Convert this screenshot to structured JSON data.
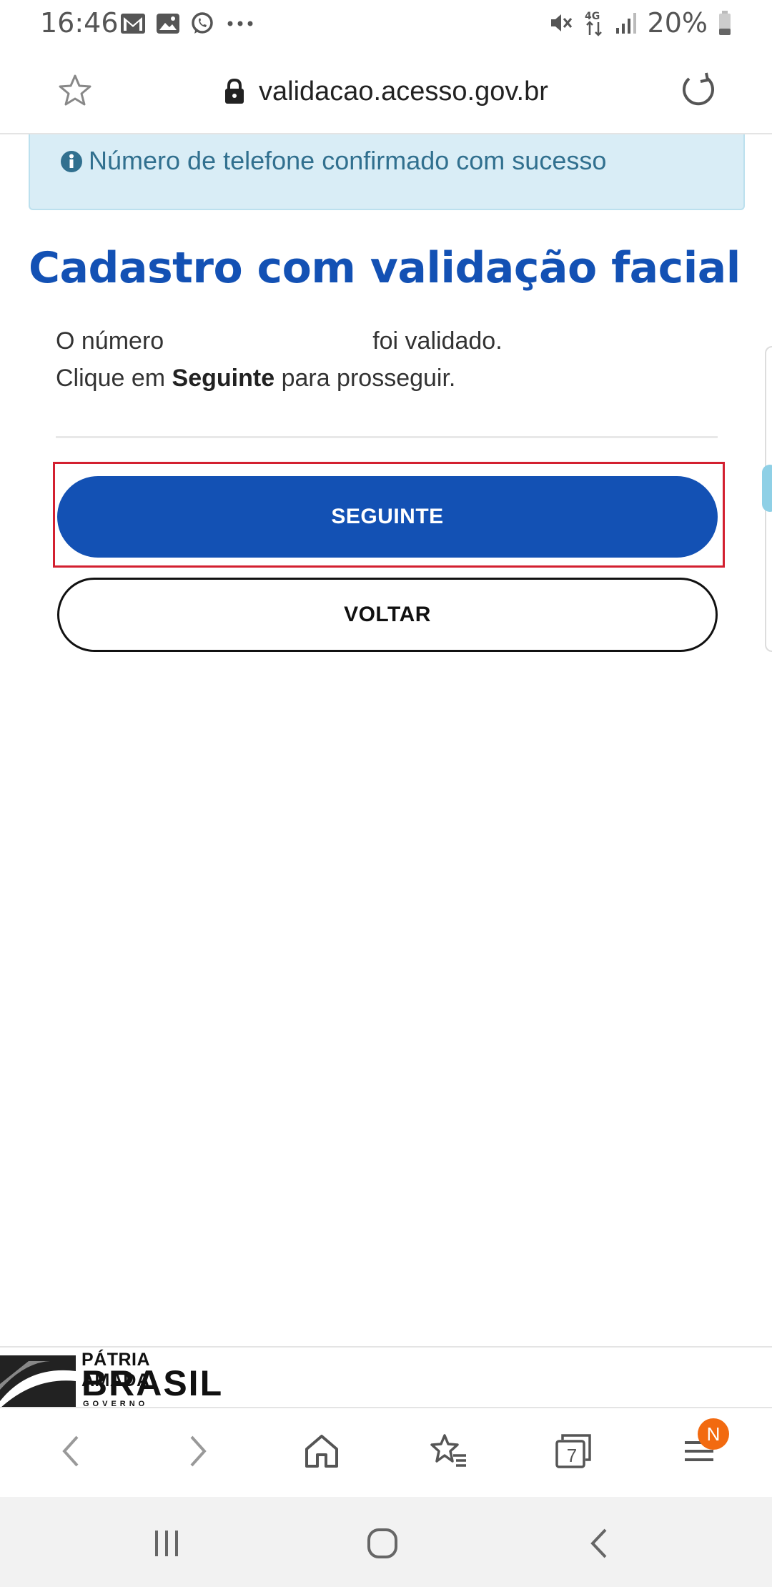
{
  "status_bar": {
    "time": "16:46",
    "battery": "20%",
    "network": "4G",
    "left_icons": [
      "gmail-icon",
      "gallery-icon",
      "whatsapp-icon",
      "more-notifications-icon"
    ],
    "right_icons": [
      "mute-icon",
      "data-4g-icon",
      "signal-icon",
      "battery-icon"
    ]
  },
  "browser": {
    "url": "validacao.acesso.gov.br",
    "tab_count": "7",
    "menu_badge": "N"
  },
  "alert": {
    "message": "Número de telefone confirmado com sucesso",
    "color": "#31708f",
    "background": "#d9edf6"
  },
  "page": {
    "title": "Cadastro com validação facial",
    "line1_start": "O número",
    "line1_end": "foi validado.",
    "line2_start": "Clique em",
    "line2_bold": "Seguinte",
    "line2_end": "para prosseguir."
  },
  "buttons": {
    "next_label": "SEGUINTE",
    "back_label": "VOLTAR",
    "primary_color": "#1351b4",
    "highlight_color": "#d32030"
  },
  "footer": {
    "logo_line1": "PÁTRIA AMADA",
    "logo_line2": "BRASIL",
    "logo_line3": "GOVERNO FEDERAL"
  }
}
